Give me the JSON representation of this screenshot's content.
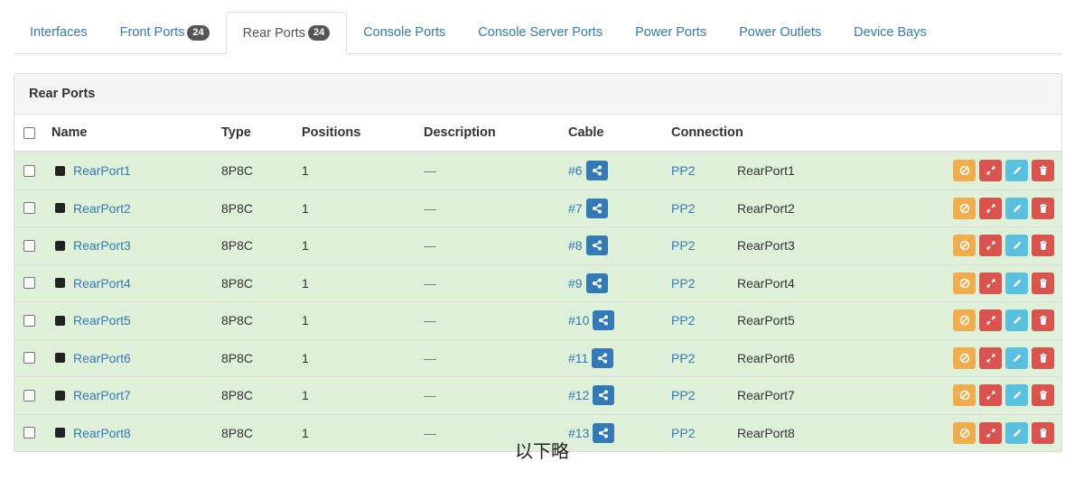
{
  "tabs": [
    {
      "label": "Interfaces",
      "badge": null,
      "active": false
    },
    {
      "label": "Front Ports",
      "badge": "24",
      "active": false
    },
    {
      "label": "Rear Ports",
      "badge": "24",
      "active": true
    },
    {
      "label": "Console Ports",
      "badge": null,
      "active": false
    },
    {
      "label": "Console Server Ports",
      "badge": null,
      "active": false
    },
    {
      "label": "Power Ports",
      "badge": null,
      "active": false
    },
    {
      "label": "Power Outlets",
      "badge": null,
      "active": false
    },
    {
      "label": "Device Bays",
      "badge": null,
      "active": false
    }
  ],
  "panel": {
    "title": "Rear Ports",
    "columns": {
      "name": "Name",
      "type": "Type",
      "positions": "Positions",
      "description": "Description",
      "cable": "Cable",
      "connection": "Connection"
    },
    "rows": [
      {
        "name": "RearPort1",
        "type": "8P8C",
        "positions": "1",
        "description": "—",
        "cable": "#6",
        "conn_device": "PP2",
        "conn_port": "RearPort1"
      },
      {
        "name": "RearPort2",
        "type": "8P8C",
        "positions": "1",
        "description": "—",
        "cable": "#7",
        "conn_device": "PP2",
        "conn_port": "RearPort2"
      },
      {
        "name": "RearPort3",
        "type": "8P8C",
        "positions": "1",
        "description": "—",
        "cable": "#8",
        "conn_device": "PP2",
        "conn_port": "RearPort3"
      },
      {
        "name": "RearPort4",
        "type": "8P8C",
        "positions": "1",
        "description": "—",
        "cable": "#9",
        "conn_device": "PP2",
        "conn_port": "RearPort4"
      },
      {
        "name": "RearPort5",
        "type": "8P8C",
        "positions": "1",
        "description": "—",
        "cable": "#10",
        "conn_device": "PP2",
        "conn_port": "RearPort5"
      },
      {
        "name": "RearPort6",
        "type": "8P8C",
        "positions": "1",
        "description": "—",
        "cable": "#11",
        "conn_device": "PP2",
        "conn_port": "RearPort6"
      },
      {
        "name": "RearPort7",
        "type": "8P8C",
        "positions": "1",
        "description": "—",
        "cable": "#12",
        "conn_device": "PP2",
        "conn_port": "RearPort7"
      },
      {
        "name": "RearPort8",
        "type": "8P8C",
        "positions": "1",
        "description": "—",
        "cable": "#13",
        "conn_device": "PP2",
        "conn_port": "RearPort8"
      }
    ]
  },
  "icons": {
    "trace": "share-icon",
    "disconnect": "ban-icon",
    "connect": "expand-arrows-icon",
    "edit": "pencil-icon",
    "delete": "trash-icon"
  },
  "colors": {
    "link": "#337ab7",
    "connected_row": "#dff0d8",
    "warning": "#f0ad4e",
    "danger": "#d9534f",
    "info": "#5bc0de"
  },
  "footer_note": "以下略"
}
